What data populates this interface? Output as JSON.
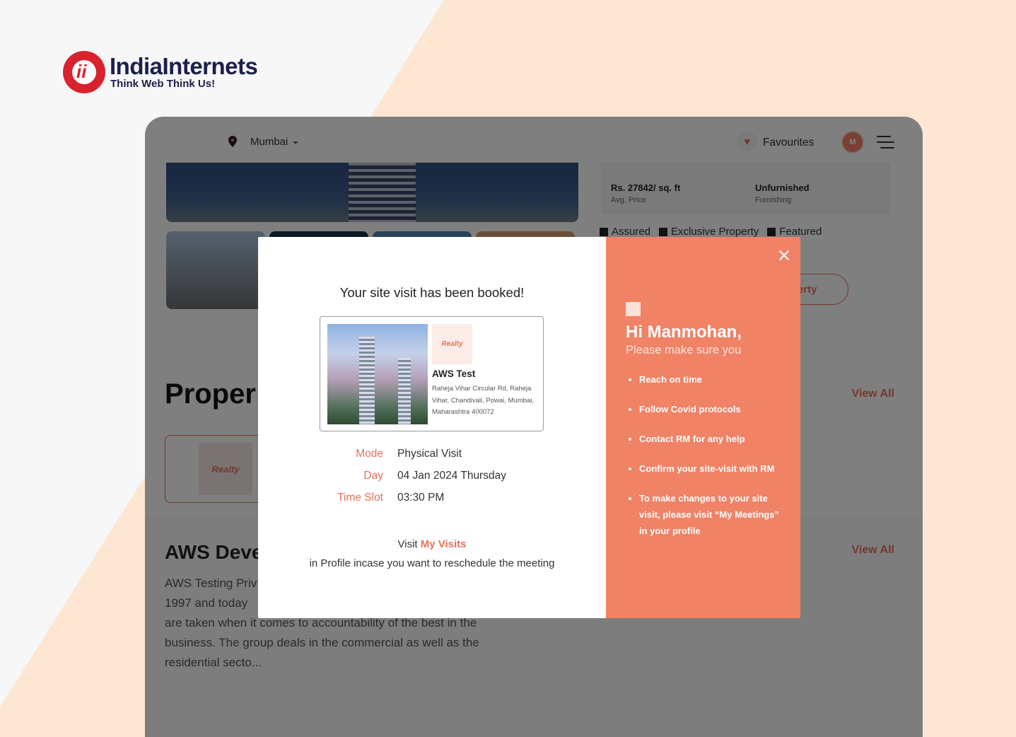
{
  "brand": {
    "name": "IndiaInternets",
    "tagline": "Think Web Think Us!"
  },
  "nav": {
    "city": "Mumbai",
    "favourites_label": "Favourites",
    "avatar_initial": "M"
  },
  "property_specs": [
    {
      "value": "Rs. 27842/ sq. ft",
      "label": "Avg. Price"
    },
    {
      "value": "Unfurnished",
      "label": "Furnishing"
    }
  ],
  "badges": [
    "Assured",
    "Exclusive Property",
    "Featured"
  ],
  "partial_button": "operty",
  "sections": {
    "properties_title": "Proper",
    "view_all": "View All",
    "developer_logo": "Realty",
    "developer_title": "AWS Deve",
    "developer_description": "AWS Testing Priv\n1997 and today \nare taken when it comes to accountability of the best in the\nbusiness. The group deals in the commercial as well as the\nresidential secto..."
  },
  "modal": {
    "title": "Your site visit has been booked!",
    "property": {
      "logo_text": "Realty",
      "name": "AWS Test",
      "address": "Raheja Vihar Circular Rd, Raheja Vihar, Chandivali, Powai, Mumbai, Maharashtra 400072"
    },
    "details": [
      {
        "key": "Mode",
        "value": "Physical Visit"
      },
      {
        "key": "Day",
        "value": "04 Jan 2024 Thursday"
      },
      {
        "key": "Time Slot",
        "value": "03:30 PM"
      }
    ],
    "note_prefix": "Visit ",
    "note_link": "My Visits",
    "note_suffix": " in Profile incase you want to reschedule the meeting",
    "greeting": "Hi Manmohan,",
    "subgreeting": "Please make sure you",
    "checklist": [
      "Reach on time",
      "Follow Covid protocols",
      "Contact RM for any help",
      "Confirm your site-visit with RM",
      "To make changes to your site visit, please visit “My Meetings” in your profile"
    ]
  },
  "colors": {
    "accent": "#f08266",
    "link": "#e8705a",
    "brand_red": "#d8222c",
    "brand_navy": "#1b1f4b",
    "backdrop": "#fde6d2"
  },
  "icons": [
    "location-pin-icon",
    "heart-icon",
    "menu-icon",
    "close-icon",
    "checkbox-icon"
  ]
}
